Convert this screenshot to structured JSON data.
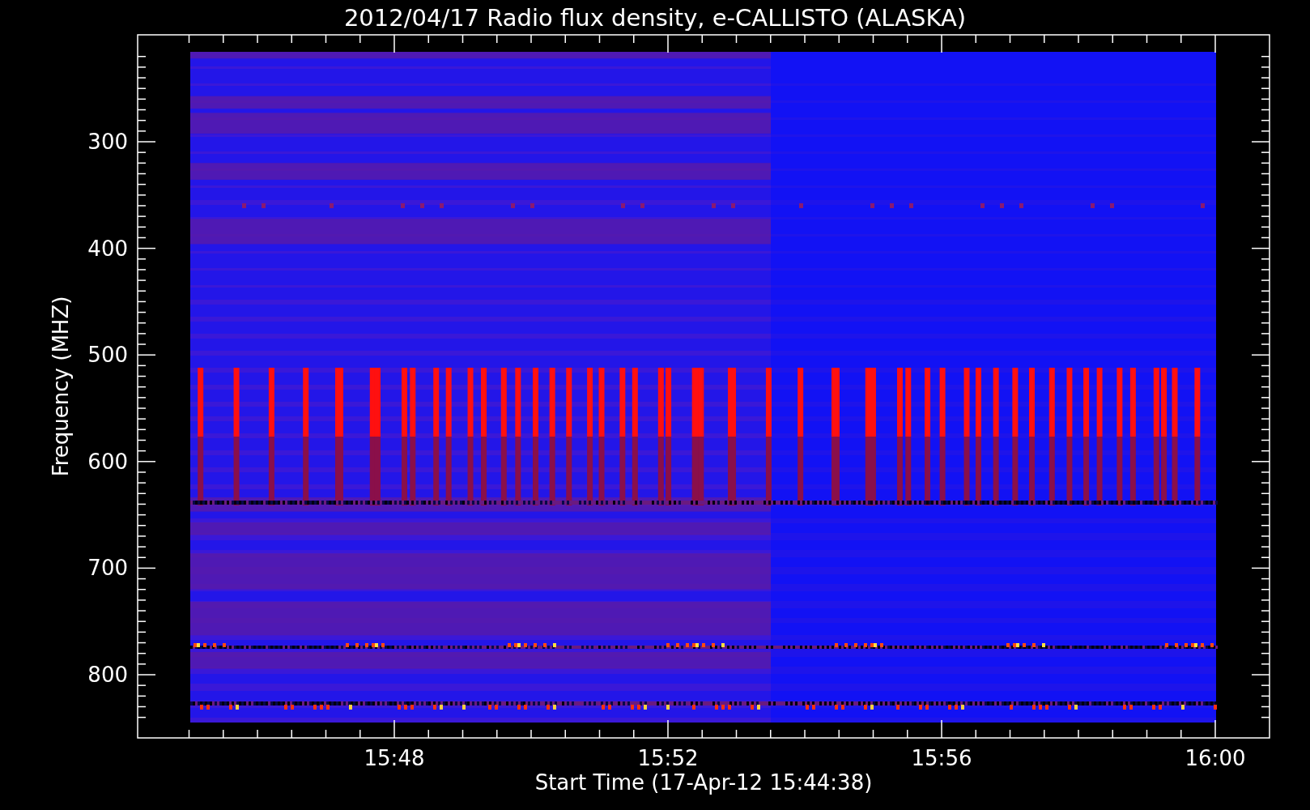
{
  "title": "2012/04/17  Radio flux density, e-CALLISTO (ALASKA)",
  "y_axis": {
    "label": "Frequency (MHZ)",
    "ticks": [
      "300",
      "400",
      "500",
      "600",
      "700",
      "800"
    ]
  },
  "x_axis": {
    "label": "Start Time (17-Apr-12 15:44:38)",
    "ticks": [
      "15:48",
      "15:52",
      "15:56",
      "16:00"
    ]
  }
}
